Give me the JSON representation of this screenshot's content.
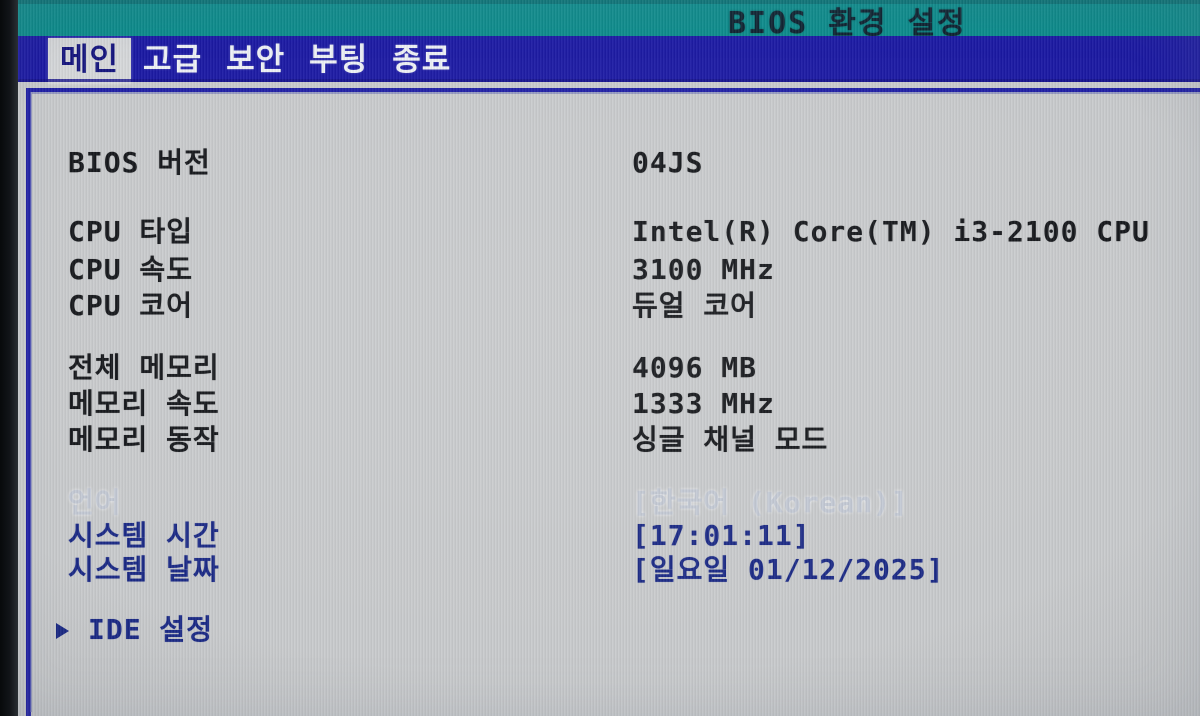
{
  "header": {
    "title": "BIOS 환경 설정",
    "title_color": "#0d2230",
    "bar_color": "#0b8c8c"
  },
  "menu": {
    "bar_color": "#1b19a4",
    "active_tab_bg": "#d6d8da",
    "active_tab_color": "#16167f",
    "tabs": [
      {
        "label": "메인",
        "active": true
      },
      {
        "label": "고급",
        "active": false
      },
      {
        "label": "보안",
        "active": false
      },
      {
        "label": "부팅",
        "active": false
      },
      {
        "label": "종료",
        "active": false
      }
    ]
  },
  "main": {
    "frame_border_color": "#1f1fa6",
    "background_color": "#c9cbcd",
    "rows": [
      {
        "label": "BIOS 버전",
        "value": "04JS"
      },
      {
        "label": "CPU 타입",
        "value": "Intel(R) Core(TM) i3-2100 CPU"
      },
      {
        "label": "CPU 속도",
        "value": "3100 MHz"
      },
      {
        "label": "CPU 코어",
        "value": "듀얼 코어"
      },
      {
        "label": "전체 메모리",
        "value": "4096 MB"
      },
      {
        "label": "메모리 속도",
        "value": "1333 MHz"
      },
      {
        "label": "메모리 동작",
        "value": "싱글 채널 모드"
      },
      {
        "label": "언어",
        "value": "[한국어 (Korean)]"
      },
      {
        "label": "시스템 시간",
        "value": "[17:01:11]"
      },
      {
        "label": "시스템 날짜",
        "value": "[일요일 01/12/2025]"
      }
    ],
    "submenu": {
      "label": "IDE 설정",
      "marker": "right-triangle-icon"
    },
    "text_colors": {
      "info_dark": "#15171b",
      "editable_blue": "#1b2a86",
      "highlighted_faded": "#c3c9d4"
    }
  }
}
